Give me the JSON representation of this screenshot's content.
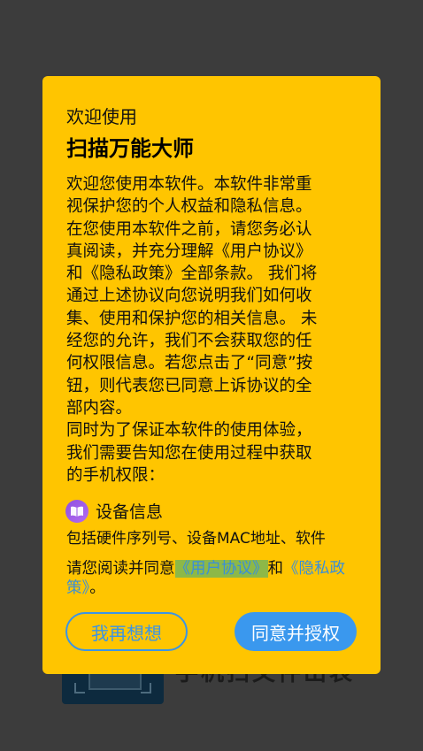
{
  "background": {
    "heading_text": "手机扫文件出表"
  },
  "dialog": {
    "title_small": "欢迎使用",
    "title_big": "扫描万能大师",
    "body": "欢迎您使用本软件。本软件非常重\n视保护您的个人权益和隐私信息。\n在您使用本软件之前，请您务必认\n真阅读，并充分理解《用户协议》\n和《隐私政策》全部条款。 我们将\n通过上述协议向您说明我们如何收\n集、使用和保护您的相关信息。 未\n经您的允许，我们不会获取您的任\n何权限信息。若您点击了“同意”按\n钮，则代表您已同意上诉协议的全\n部内容。\n同时为了保证本软件的使用体验，\n我们需要告知您在使用过程中获取\n的手机权限：",
    "permission": {
      "icon": "book-icon",
      "title": "设备信息",
      "desc": "包括硬件序列号、设备MAC地址、软件"
    },
    "agree": {
      "prefix": "请您阅读并同意",
      "user_agreement_link": "《用户协议》",
      "and": "和",
      "privacy_link": "《隐私政策》",
      "suffix": "。"
    },
    "cancel_button": "我再想想",
    "ok_button": "同意并授权"
  },
  "colors": {
    "dialog_bg": "#ffc500",
    "accent_blue": "#3a98ee",
    "link_highlight": "#8db848"
  }
}
